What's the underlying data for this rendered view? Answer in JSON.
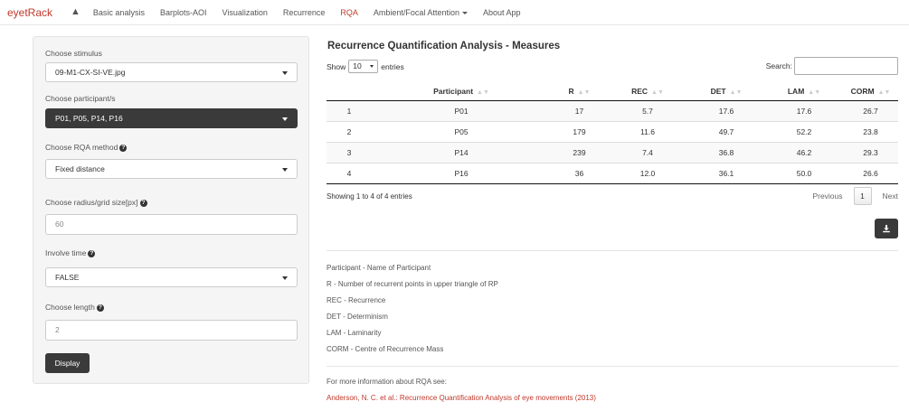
{
  "navbar": {
    "brand": "eyetRack",
    "items": [
      {
        "label": "Basic analysis"
      },
      {
        "label": "Barplots-AOI"
      },
      {
        "label": "Visualization"
      },
      {
        "label": "Recurrence"
      },
      {
        "label": "RQA"
      },
      {
        "label": "Ambient/Focal Attention"
      },
      {
        "label": "About App"
      }
    ],
    "active_item": "RQA",
    "home_icon": "home-icon"
  },
  "sidebar": {
    "stimulus_label": "Choose stimulus",
    "stimulus_value": "09-M1-CX-SI-VE.jpg",
    "participant_label": "Choose participant/s",
    "participant_value": "P01, P05, P14, P16",
    "method_label": "Choose RQA method",
    "method_value": "Fixed distance",
    "radius_label": "Choose radius/grid size[px]",
    "radius_value": "60",
    "time_label": "Involve time",
    "time_value": "FALSE",
    "length_label": "Choose length",
    "length_value": "2",
    "display_button": "Display",
    "help_icon": "question-circle-icon"
  },
  "main": {
    "title": "Recurrence Quantification Analysis - Measures",
    "show_label": "Show",
    "show_value": "10",
    "entries_label": "entries",
    "search_label": "Search:",
    "search_value": "",
    "columns": [
      "",
      "Participant",
      "R",
      "REC",
      "DET",
      "LAM",
      "CORM"
    ],
    "rows": [
      [
        "1",
        "P01",
        "17",
        "5.7",
        "17.6",
        "17.6",
        "26.7"
      ],
      [
        "2",
        "P05",
        "179",
        "11.6",
        "49.7",
        "52.2",
        "23.8"
      ],
      [
        "3",
        "P14",
        "239",
        "7.4",
        "36.8",
        "46.2",
        "29.3"
      ],
      [
        "4",
        "P16",
        "36",
        "12.0",
        "36.1",
        "50.0",
        "26.6"
      ]
    ],
    "info": "Showing 1 to 4 of 4 entries",
    "pager": {
      "previous": "Previous",
      "page": "1",
      "next": "Next"
    },
    "download_icon": "download-icon",
    "legend": [
      "Participant - Name of Participant",
      "R - Number of recurrent points in upper triangle of RP",
      "REC - Recurrence",
      "DET - Determinism",
      "LAM - Laminarity",
      "CORM - Centre of Recurrence Mass"
    ],
    "more_info": "For more information about RQA see:",
    "reference": "Anderson, N. C. et al.: Recurrence Quantification Analysis of eye movements (2013)"
  },
  "colors": {
    "accent": "#c0392b",
    "dark_button": "#3a3a3a",
    "panel": "#f5f5f5"
  }
}
